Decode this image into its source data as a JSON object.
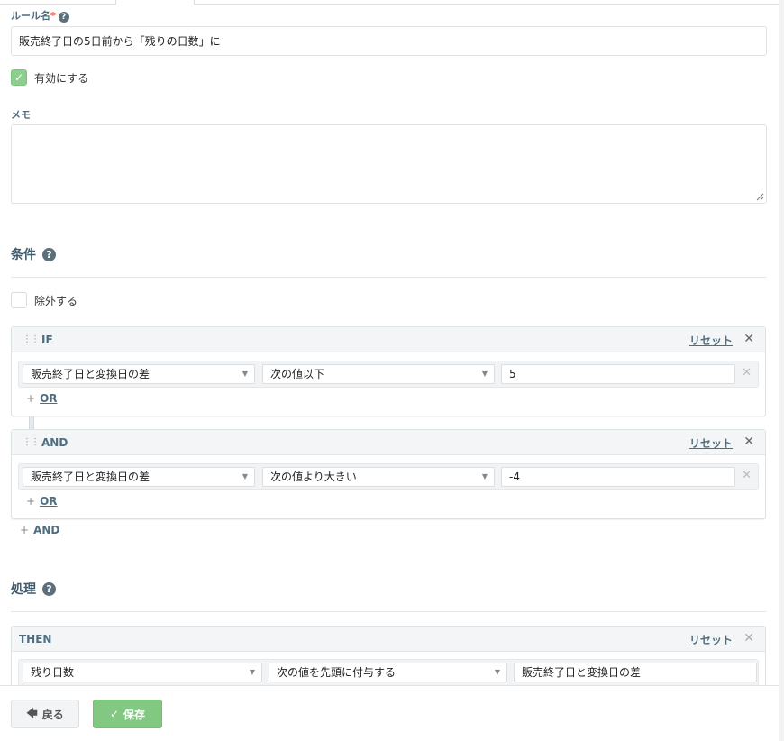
{
  "rule_name": {
    "label": "ルール名",
    "required_mark": "*",
    "value": "販売終了日の5日前から「残りの日数」に"
  },
  "enabled": {
    "label": "有効にする",
    "checked": true
  },
  "memo": {
    "label": "メモ",
    "value": ""
  },
  "conditions": {
    "title": "条件",
    "exclude": {
      "label": "除外する",
      "checked": false
    },
    "blocks": [
      {
        "title": "IF",
        "reset": "リセット",
        "row": {
          "field": "販売終了日と変換日の差",
          "operator": "次の値以下",
          "value": "5"
        },
        "add_or": "OR"
      },
      {
        "title": "AND",
        "reset": "リセット",
        "row": {
          "field": "販売終了日と変換日の差",
          "operator": "次の値より大きい",
          "value": "-4"
        },
        "add_or": "OR"
      }
    ],
    "add_and": "AND"
  },
  "actions": {
    "title": "処理",
    "block": {
      "title": "THEN",
      "reset": "リセット",
      "row": {
        "field": "残り日数",
        "operator": "次の値を先頭に付与する",
        "value": "販売終了日と変換日の差"
      }
    }
  },
  "footer": {
    "back_label": "戻る",
    "save_label": "保存"
  },
  "colors": {
    "accent": "#4e6e80",
    "save": "#82c882",
    "checkbox": "#8ccf8c"
  }
}
